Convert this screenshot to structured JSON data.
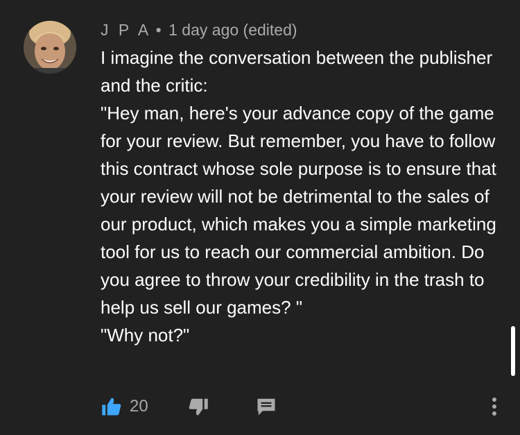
{
  "comment": {
    "author": "J P A",
    "separator": "•",
    "time": "1 day ago (edited)",
    "paragraphs": [
      "I imagine the conversation between the publisher and the critic:",
      "\"Hey man, here's your advance copy of the game for your review. But remember, you have to follow this contract whose sole purpose is to ensure that your review will not be detrimental to the sales of our product, which makes you a simple marketing tool for us to reach our commercial ambition. Do you agree to throw your credibility in the trash to help us sell our games? \"",
      "\"Why not?\""
    ]
  },
  "actions": {
    "like_count": "20",
    "like_icon": "thumbs-up-icon",
    "dislike_icon": "thumbs-down-icon",
    "reply_icon": "reply-icon",
    "more_icon": "more-vertical-icon"
  },
  "colors": {
    "background": "#212121",
    "text": "#ffffff",
    "meta": "#aaaaaa",
    "like_active": "#3ea6ff"
  }
}
